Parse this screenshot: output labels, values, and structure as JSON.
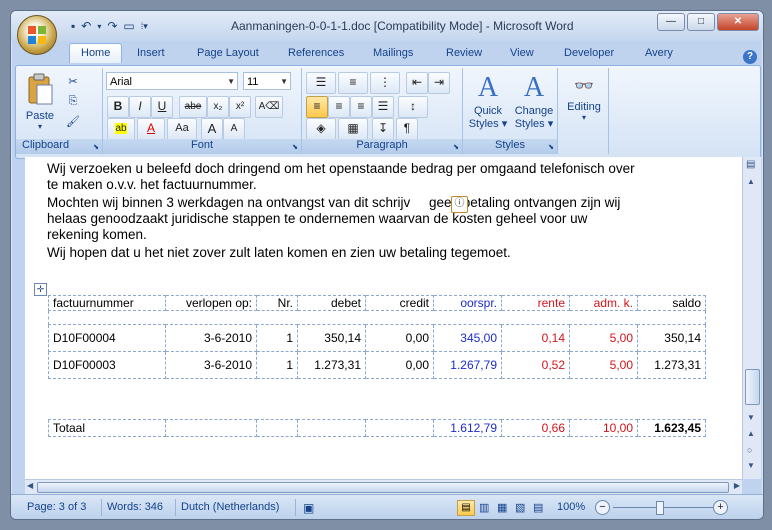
{
  "window": {
    "title": "Aanmaningen-0-0-1-1.doc [Compatibility Mode] - Microsoft Word",
    "controls": [
      "—",
      "□",
      "✕"
    ]
  },
  "quick_access": [
    "save-icon",
    "undo-icon",
    "redo-icon",
    "customize-icon"
  ],
  "tabs": [
    "Home",
    "Insert",
    "Page Layout",
    "References",
    "Mailings",
    "Review",
    "View",
    "Developer",
    "Avery"
  ],
  "active_tab": "Home",
  "ribbon": {
    "clipboard": {
      "label": "Clipboard",
      "paste": "Paste"
    },
    "font": {
      "label": "Font",
      "font_name": "Arial",
      "font_size": "11",
      "buttons": [
        "B",
        "I",
        "U",
        "abe",
        "x₂",
        "x²",
        "Aa",
        "A",
        "A"
      ]
    },
    "paragraph": {
      "label": "Paragraph"
    },
    "styles": {
      "label": "Styles",
      "quick": "Quick",
      "quick2": "Styles",
      "change": "Change",
      "change2": "Styles"
    },
    "editing": {
      "label": "Editing"
    }
  },
  "document": {
    "lines": [
      "Wij verzoeken u beleefd doch dringend om het openstaande bedrag per omgaand telefonisch over",
      "te maken o.v.v. het factuurnummer.",
      "Mochten wij binnen 3 werkdagen na ontvangst van dit schrijv     geen betaling ontvangen zijn wij",
      "helaas genoodzaakt juridische stappen te ondernemen waarvan de kosten geheel voor uw",
      "rekening komen.",
      "Wij hopen dat u het niet zover zult laten komen en zien uw betaling tegemoet."
    ],
    "table": {
      "headers": [
        "factuurnummer",
        "verlopen op:",
        "Nr.",
        "debet",
        "credit",
        "oorspr.",
        "rente",
        "adm. k.",
        "saldo"
      ],
      "rows": [
        [
          "D10F00004",
          "3-6-2010",
          "1",
          "350,14",
          "0,00",
          "345,00",
          "0,14",
          "5,00",
          "350,14"
        ],
        [
          "D10F00003",
          "3-6-2010",
          "1",
          "1.273,31",
          "0,00",
          "1.267,79",
          "0,52",
          "5,00",
          "1.273,31"
        ]
      ],
      "total": [
        "Totaal",
        "",
        "",
        "",
        "",
        "1.612,79",
        "0,66",
        "10,00",
        "1.623,45"
      ]
    }
  },
  "status": {
    "page": "Page: 3 of 3",
    "words": "Words: 346",
    "language": "Dutch (Netherlands)",
    "zoom": "100%"
  }
}
